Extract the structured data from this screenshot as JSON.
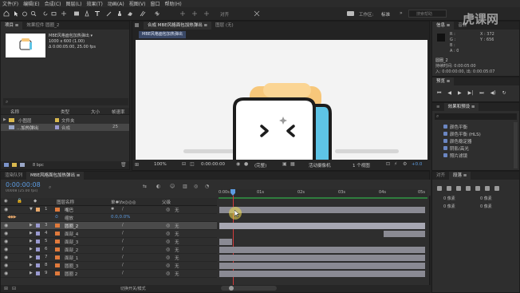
{
  "menu": [
    "文件(F)",
    "编辑(E)",
    "合成(C)",
    "图层(L)",
    "效果(T)",
    "动画(A)",
    "视图(V)",
    "窗口",
    "帮助(H)"
  ],
  "toolbar": {
    "icons": [
      "home-icon",
      "hand-icon",
      "zoom-icon",
      "rotate-icon",
      "camera-icon",
      "pan-behind-icon",
      "rectangle-icon",
      "pen-icon",
      "type-icon",
      "brush-icon",
      "clone-stamp-icon",
      "eraser-icon",
      "roto-brush-icon",
      "puppet-icon"
    ],
    "align_label": "对齐",
    "workspace_label": "工作区:",
    "workspace_value": "标准",
    "search_placeholder": "搜索帮助"
  },
  "project": {
    "tab_label": "项目 ≡",
    "effect_controls_tab": "效果控件 圆圈_2",
    "comp_name": "MBE风格面包加热弹出 ▾",
    "comp_size": "1000 x 600 (1.00)",
    "comp_duration": "Δ 0:00:05:00, 25.00 fps",
    "columns": {
      "name": "名称",
      "type": "类型",
      "size": "大小",
      "rate": "帧速率"
    },
    "items": [
      {
        "name": "小图层",
        "type": "文件夹",
        "size": "",
        "rate": ""
      },
      {
        "name": "...加热弹出",
        "type": "合成",
        "size": "",
        "rate": "25"
      }
    ],
    "footer_bpc": "8 bpc"
  },
  "viewer": {
    "tab_label": "合成 MBE风格面包加热弹出 ≡",
    "layer_tab": "图层 (无)",
    "breadcrumb": "MBE风格面包加热弹出",
    "zoom": "100%",
    "timecode": "0:00:00:00",
    "resolution": "(完整)",
    "camera": "活动摄像机",
    "views": "1 个视图",
    "exposure": "+0.0"
  },
  "info": {
    "tab_label": "信息 ≡",
    "audio_tab": "音频",
    "r": "R :",
    "g": "G :",
    "b": "B :",
    "a": "A : 0",
    "x": "X : 372",
    "y": "Y : 656",
    "layer_name": "圆圈_2",
    "duration": "持续时间: 0:00:05:00",
    "in": "入: 0:00:00:00, 出: 0:00:05:07"
  },
  "preview": {
    "tab_label": "预览 ≡"
  },
  "effects": {
    "tab_label": "效果和预设 ≡",
    "items": [
      "颜色平衡",
      "颜色平衡 (HLS)",
      "颜色稳定器",
      "阴影/高光",
      "照片滤镜"
    ]
  },
  "align_panel": {
    "tab_label": "对齐",
    "para_tab": "段落 ≡",
    "labels": [
      "0 像素",
      "0 像素",
      "0 像素",
      "0 像素"
    ]
  },
  "timeline": {
    "render_tab": "渲染队列",
    "comp_tab": "MBE风格面包加热弹出 ≡",
    "timecode": "0:00:00:08",
    "fps_note": "00008 (25.00 fps)",
    "columns": {
      "name": "图层名称",
      "switches": "单✱\\fx◎◎◎",
      "parent": "父级"
    },
    "layers": [
      {
        "num": "1",
        "name": "嘴巴",
        "parent": "无",
        "color": "#e7a86c"
      },
      {
        "num": "",
        "name": "缩放",
        "parent": "",
        "color": "",
        "value": "0.0,0.0%"
      },
      {
        "num": "3",
        "name": "圆圈_2",
        "parent": "无",
        "color": "#9a9ad0"
      },
      {
        "num": "4",
        "name": "面部_4",
        "parent": "无",
        "color": "#9a9ad0"
      },
      {
        "num": "5",
        "name": "面部_3",
        "parent": "无",
        "color": "#9a9ad0"
      },
      {
        "num": "6",
        "name": "面部_2",
        "parent": "无",
        "color": "#9a9ad0"
      },
      {
        "num": "7",
        "name": "面部_1",
        "parent": "无",
        "color": "#9a9ad0"
      },
      {
        "num": "8",
        "name": "圆圈_3",
        "parent": "无",
        "color": "#9a9ad0"
      },
      {
        "num": "9",
        "name": "圆圈 2",
        "parent": "无",
        "color": "#9a9ad0"
      }
    ],
    "ruler_labels": [
      "0:00s",
      "01s",
      "02s",
      "03s",
      "04s",
      "05s"
    ],
    "footer_label": "切换开关/模式"
  },
  "watermark": "虎课网"
}
